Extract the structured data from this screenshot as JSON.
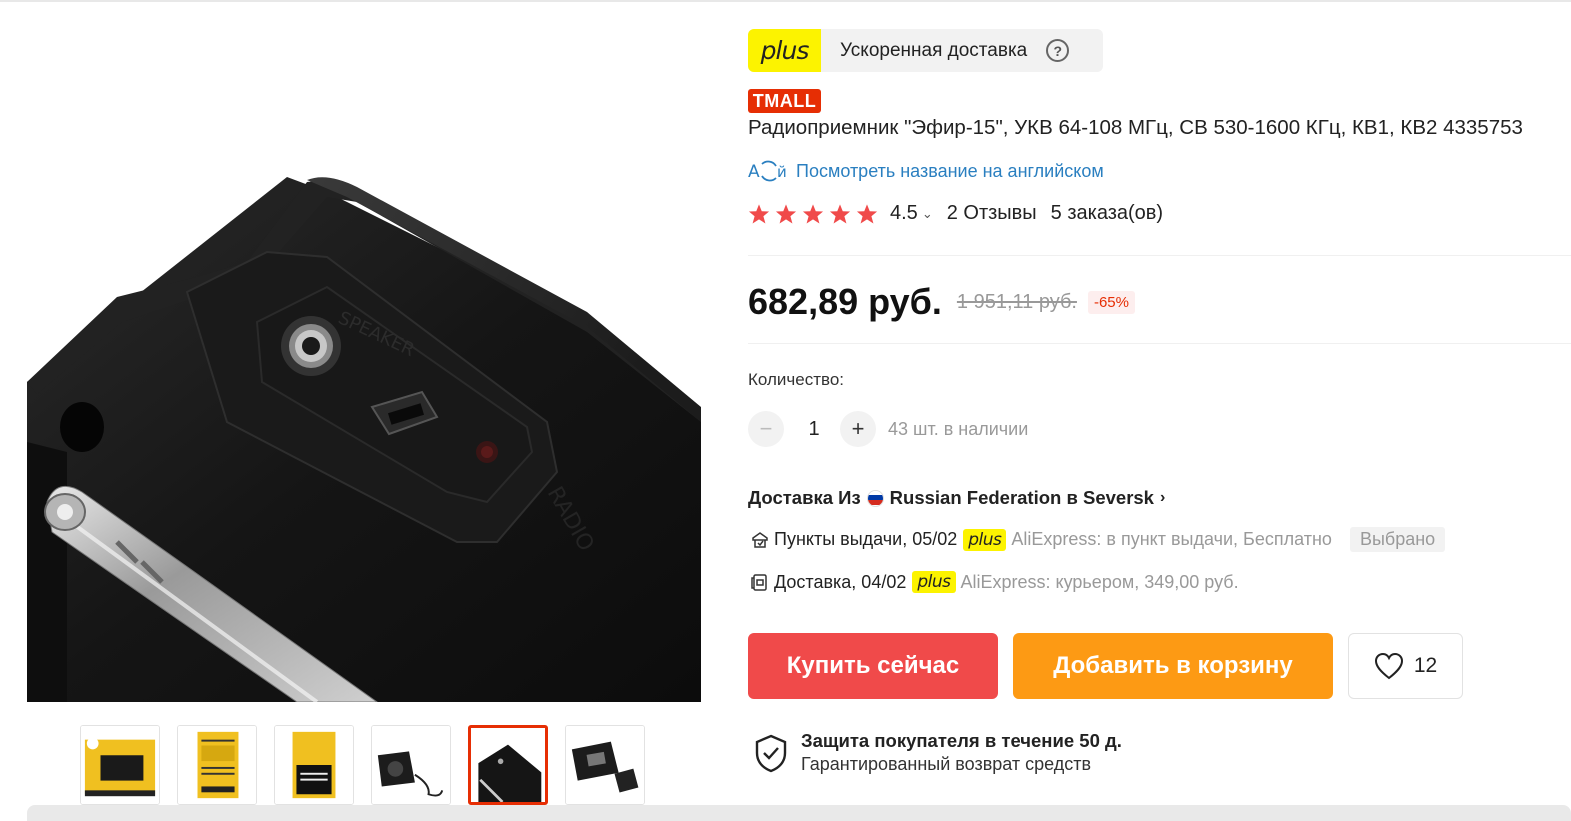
{
  "plus_banner": {
    "logo_text": "plus",
    "label": "Ускоренная доставка",
    "help_symbol": "?",
    "logo_color": "#fcf300"
  },
  "store_badge": "TMALL",
  "product": {
    "title": "Радиоприемник \"Эфир-15\", УКВ 64-108 МГц, СВ 530-1600 КГц, КВ1, КВ2 4335753",
    "translate_link": "Посмотреть название на английском"
  },
  "rating": {
    "stars_filled": 5,
    "value": "4.5",
    "reviews": "2 Отзывы",
    "orders": "5 заказа(ов)",
    "star_color": "#f04a4a"
  },
  "price": {
    "current": "682,89 руб.",
    "old": "1 951,11 руб.",
    "discount": "-65%"
  },
  "quantity": {
    "label": "Количество:",
    "minus": "−",
    "value": "1",
    "plus": "+",
    "stock": "43 шт. в наличии"
  },
  "shipping": {
    "header_prefix": "Доставка Из",
    "header_route": "Russian Federation в Seversk",
    "options": [
      {
        "icon": "pickup-point-icon",
        "label": "Пункты выдачи, 05/02",
        "badge": "plus",
        "description": "AliExpress: в пункт выдачи, Бесплатно",
        "chosen": "Выбрано"
      },
      {
        "icon": "courier-delivery-icon",
        "label": "Доставка, 04/02",
        "badge": "plus",
        "description": "AliExpress: курьером, 349,00 руб."
      }
    ]
  },
  "actions": {
    "buy_now": "Купить сейчас",
    "add_to_cart": "Добавить в корзину",
    "wishlist_count": "12",
    "buy_color": "#f04a4a",
    "cart_color": "#fd9a14"
  },
  "protection": {
    "title": "Защита покупателя в течение 50 д.",
    "subtitle": "Гарантированный возврат средств"
  },
  "gallery": {
    "thumbnail_count": 6,
    "active_index": 4,
    "active_border": "#e62e04"
  }
}
